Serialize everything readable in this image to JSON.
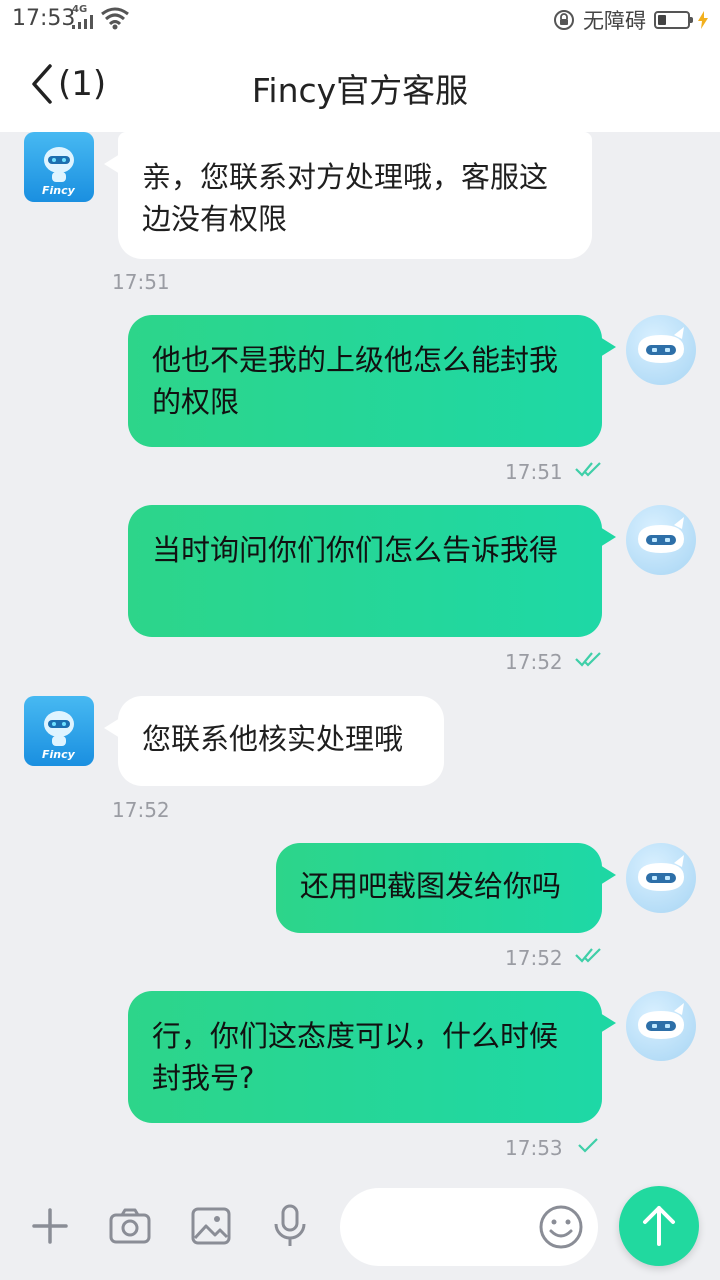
{
  "status_bar": {
    "time": "17:53",
    "network": "4G",
    "accessibility_label": "无障碍",
    "battery_level": 0.3
  },
  "header": {
    "back_count": "(1)",
    "title": "Fincy官方客服"
  },
  "agent_avatar_text": "Fincy",
  "messages": [
    {
      "from": "agent",
      "text": "亲，您联系对方处理哦，客服这边没有权限",
      "time": "17:51"
    },
    {
      "from": "user",
      "text": "他也不是我的上级他怎么能封我的权限",
      "time": "17:51",
      "status": "read"
    },
    {
      "from": "user",
      "text": "当时询问你们你们怎么告诉我得",
      "time": "17:52",
      "status": "read"
    },
    {
      "from": "agent",
      "text": "您联系他核实处理哦",
      "time": "17:52"
    },
    {
      "from": "user",
      "text": "还用吧截图发给你吗",
      "time": "17:52",
      "status": "read"
    },
    {
      "from": "user",
      "text": "行，你们这态度可以，什么时候封我号?",
      "time": "17:53",
      "status": "sent"
    }
  ],
  "input": {
    "placeholder": "",
    "value": ""
  },
  "colors": {
    "accent": "#21d99f",
    "out_bubble": "#2dd58a",
    "check": "#3fcfa8"
  },
  "icons": [
    "plus-icon",
    "camera-icon",
    "image-icon",
    "microphone-icon",
    "emoji-icon",
    "send-arrow-icon"
  ]
}
